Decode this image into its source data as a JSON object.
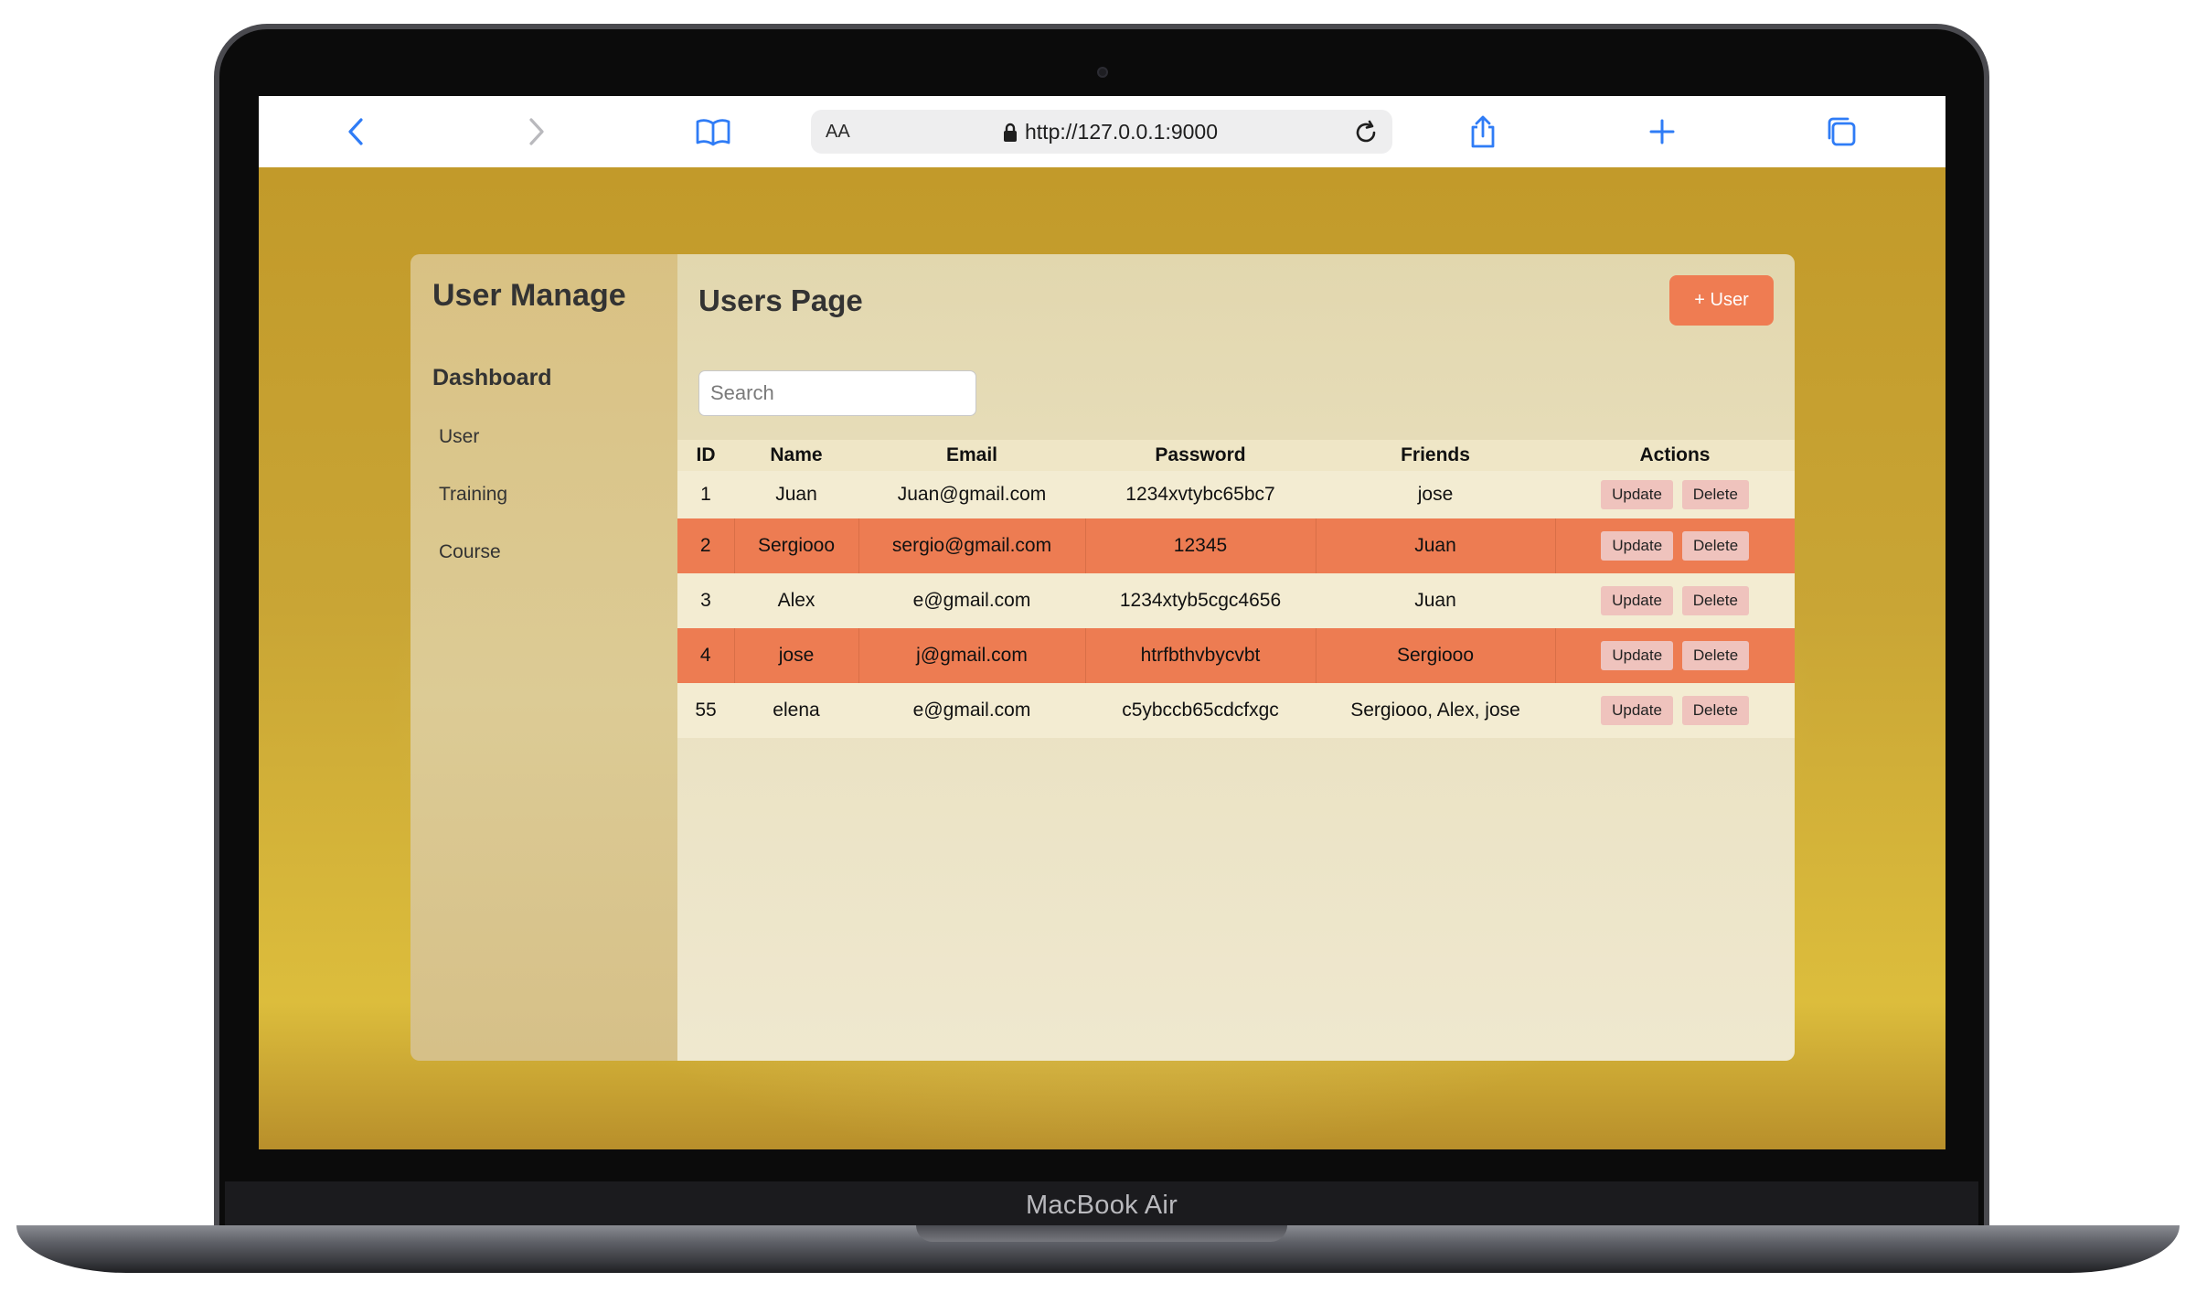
{
  "device": {
    "label": "MacBook Air"
  },
  "browser": {
    "url": "http://127.0.0.1:9000",
    "text_size_label": "AA"
  },
  "sidebar": {
    "title": "User Manage",
    "section": "Dashboard",
    "items": [
      {
        "label": "User"
      },
      {
        "label": "Training"
      },
      {
        "label": "Course"
      }
    ]
  },
  "main": {
    "title": "Users Page",
    "add_button": "+ User",
    "search_placeholder": "Search"
  },
  "table": {
    "columns": [
      "ID",
      "Name",
      "Email",
      "Password",
      "Friends",
      "Actions"
    ],
    "update_label": "Update",
    "delete_label": "Delete",
    "rows": [
      {
        "id": "1",
        "name": "Juan",
        "email": "Juan@gmail.com",
        "password": "1234xvtybc65bc7",
        "friends": "jose"
      },
      {
        "id": "2",
        "name": "Sergiooo",
        "email": "sergio@gmail.com",
        "password": "12345",
        "friends": "Juan"
      },
      {
        "id": "3",
        "name": "Alex",
        "email": "e@gmail.com",
        "password": "1234xtyb5cgc4656",
        "friends": "Juan"
      },
      {
        "id": "4",
        "name": "jose",
        "email": "j@gmail.com",
        "password": "htrfbthvbycvbt",
        "friends": "Sergiooo"
      },
      {
        "id": "55",
        "name": "elena",
        "email": "e@gmail.com",
        "password": "c5ybccb65cdcfxgc",
        "friends": "Sergiooo, Alex, jose"
      }
    ]
  },
  "colors": {
    "accent": "#ef7c52",
    "highlight_row": "#ed7c52",
    "action_button": "#efc3bd",
    "page_background": "#c9a535"
  }
}
